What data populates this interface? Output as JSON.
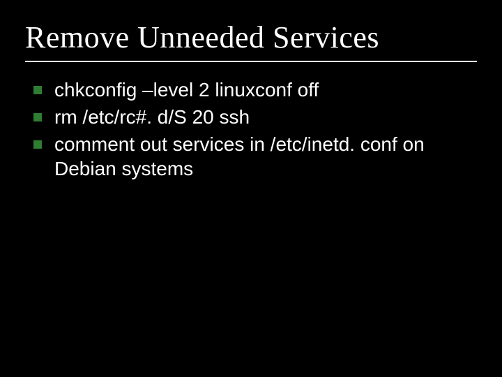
{
  "slide": {
    "title": "Remove Unneeded Services",
    "bullets": [
      "chkconfig –level 2 linuxconf off",
      "rm /etc/rc#. d/S 20 ssh",
      "comment out services in /etc/inetd. conf on Debian systems"
    ]
  }
}
